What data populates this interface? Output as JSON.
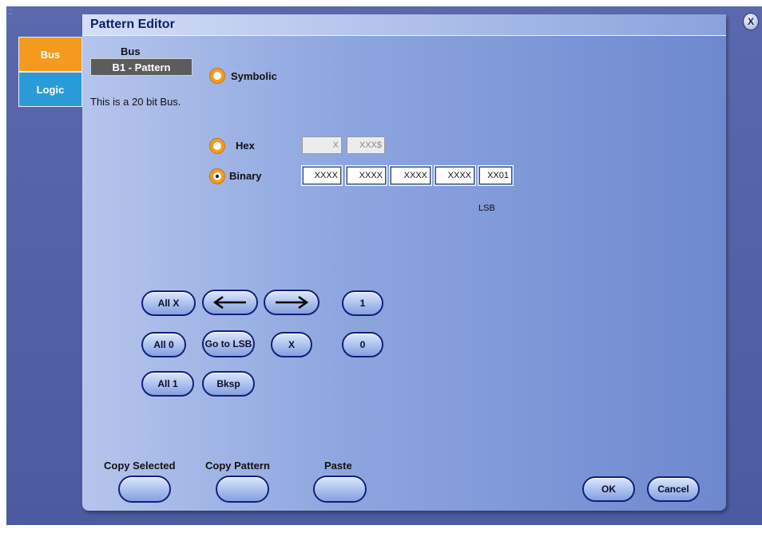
{
  "panel": {
    "title": "Pattern Editor"
  },
  "tabs": [
    {
      "label": "Bus"
    },
    {
      "label": "Logic"
    }
  ],
  "bus": {
    "label": "Bus",
    "selected": "B1 - Pattern",
    "description": "This is a 20 bit Bus."
  },
  "radios": {
    "symbolic": "Symbolic",
    "hex": "Hex",
    "binary": "Binary",
    "selected": "Binary"
  },
  "hex_fields": [
    "X",
    "XXX$"
  ],
  "binary_fields": [
    "XXXX",
    "XXXX",
    "XXXX",
    "XXXX",
    "XX01"
  ],
  "lsb_label": "LSB",
  "keypad": {
    "all_x": "All X",
    "all_0": "All 0",
    "all_1": "All 1",
    "left": "left-arrow-icon",
    "right": "right-arrow-icon",
    "go_to_lsb": "Go to LSB",
    "x": "X",
    "bksp": "Bksp",
    "one": "1",
    "zero": "0"
  },
  "clipboard": {
    "copy_selected": "Copy Selected",
    "copy_pattern": "Copy Pattern",
    "paste": "Paste"
  },
  "dialog": {
    "ok": "OK",
    "cancel": "Cancel",
    "close": "X"
  },
  "colors": {
    "accent_orange": "#f49a1e",
    "tab_blue": "#2b9bd8",
    "button_border": "#10207a"
  }
}
